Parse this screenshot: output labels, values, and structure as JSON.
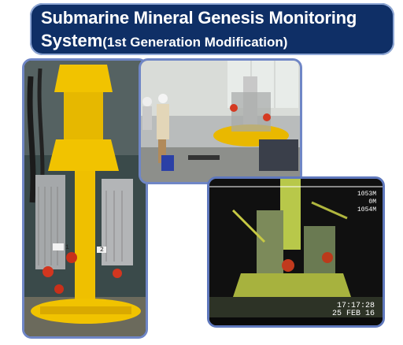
{
  "title": {
    "line1": "Submarine Mineral Genesis Monitoring",
    "line2_main": "System",
    "line2_sub": "(1st Generation Modification)"
  },
  "photos": {
    "workshop_label_1": "1",
    "workshop_label_2": "2",
    "seafloor_overlay": {
      "depth_1": "1053M",
      "depth_2": "0M",
      "depth_3": "1054M",
      "time": "17:17:28",
      "date": "25 FEB 16"
    }
  },
  "colors": {
    "title_bg": "#0f2f66",
    "frame": "#6f86c6",
    "instrument_yellow": "#f1c300"
  }
}
